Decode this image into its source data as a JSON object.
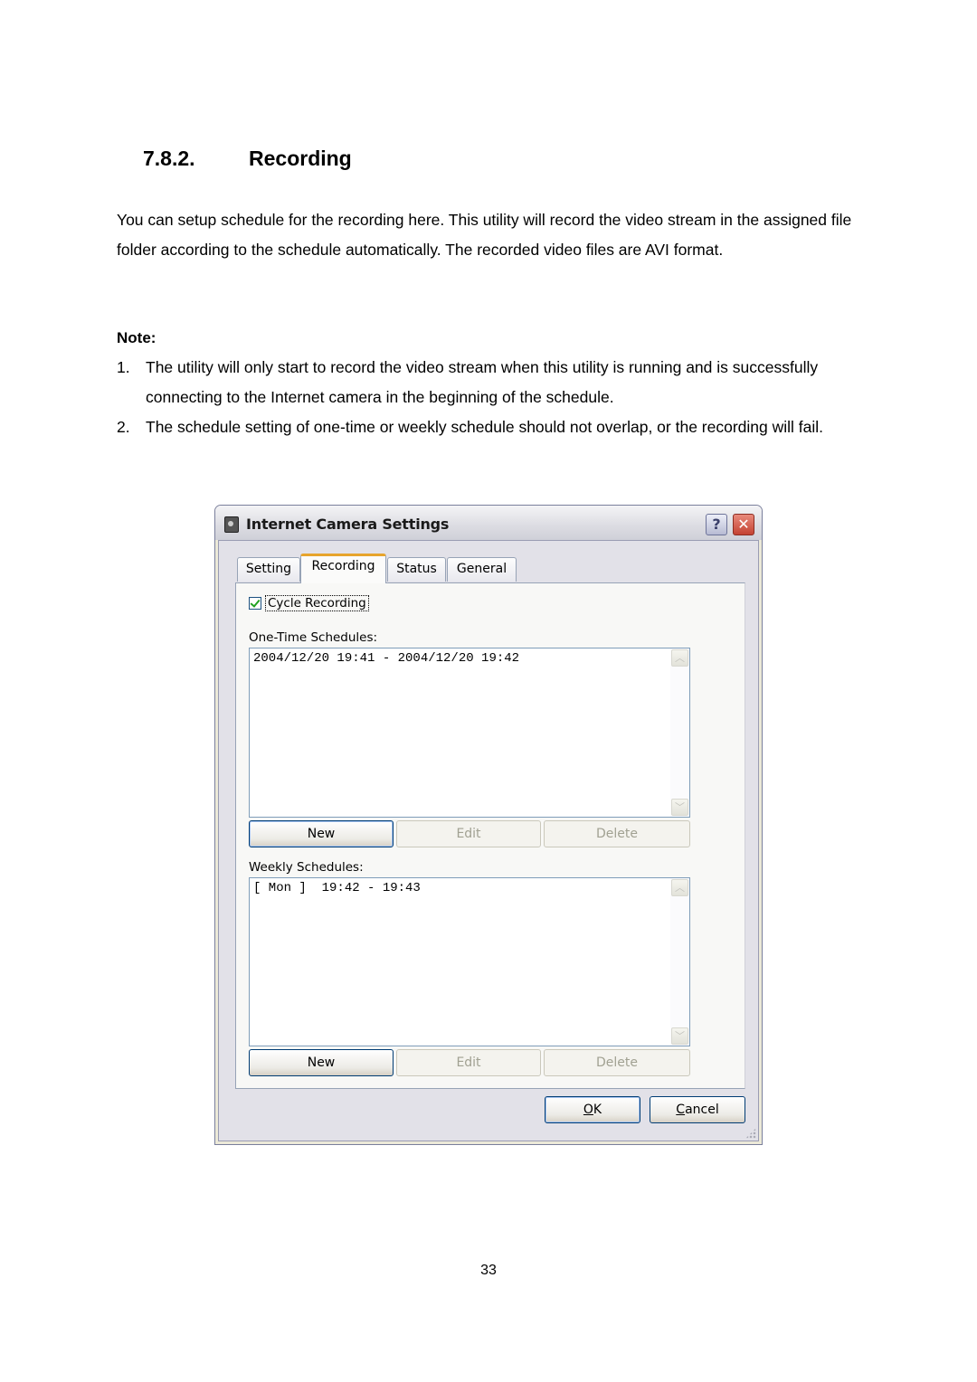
{
  "document": {
    "section_number": "7.8.2.",
    "section_title": "Recording",
    "intro": "You can setup schedule for the recording here. This utility will record the video stream in the assigned file folder according to the schedule automatically. The recorded video files are AVI format.",
    "note_label": "Note:",
    "notes": [
      {
        "index": "1.",
        "text": "The utility will only start to record the video stream when this utility is running and is successfully connecting to the Internet camera in the beginning of the schedule."
      },
      {
        "index": "2.",
        "text": "The schedule setting of one-time or weekly schedule should not overlap, or the recording will fail."
      }
    ],
    "page_number": "33"
  },
  "dialog": {
    "title": "Internet Camera Settings",
    "help_glyph": "?",
    "close_glyph": "✕",
    "tabs": [
      {
        "label": "Setting",
        "active": false
      },
      {
        "label": "Recording",
        "active": true
      },
      {
        "label": "Status",
        "active": false
      },
      {
        "label": "General",
        "active": false
      }
    ],
    "cycle_recording": {
      "label": "Cycle Recording",
      "checked": true
    },
    "one_time": {
      "label": "One-Time Schedules:",
      "items": [
        "2004/12/20 19:41 - 2004/12/20 19:42"
      ],
      "buttons": {
        "new": "New",
        "edit": "Edit",
        "delete": "Delete"
      }
    },
    "weekly": {
      "label": "Weekly Schedules:",
      "items": [
        "[ Mon ]  19:42 - 19:43"
      ],
      "buttons": {
        "new": "New",
        "edit": "Edit",
        "delete": "Delete"
      }
    },
    "scroll_up_glyph": "︿",
    "scroll_down_glyph": "﹀",
    "ok": {
      "mnemonic": "O",
      "rest": "K"
    },
    "cancel": {
      "mnemonic": "C",
      "rest": "ancel"
    }
  }
}
